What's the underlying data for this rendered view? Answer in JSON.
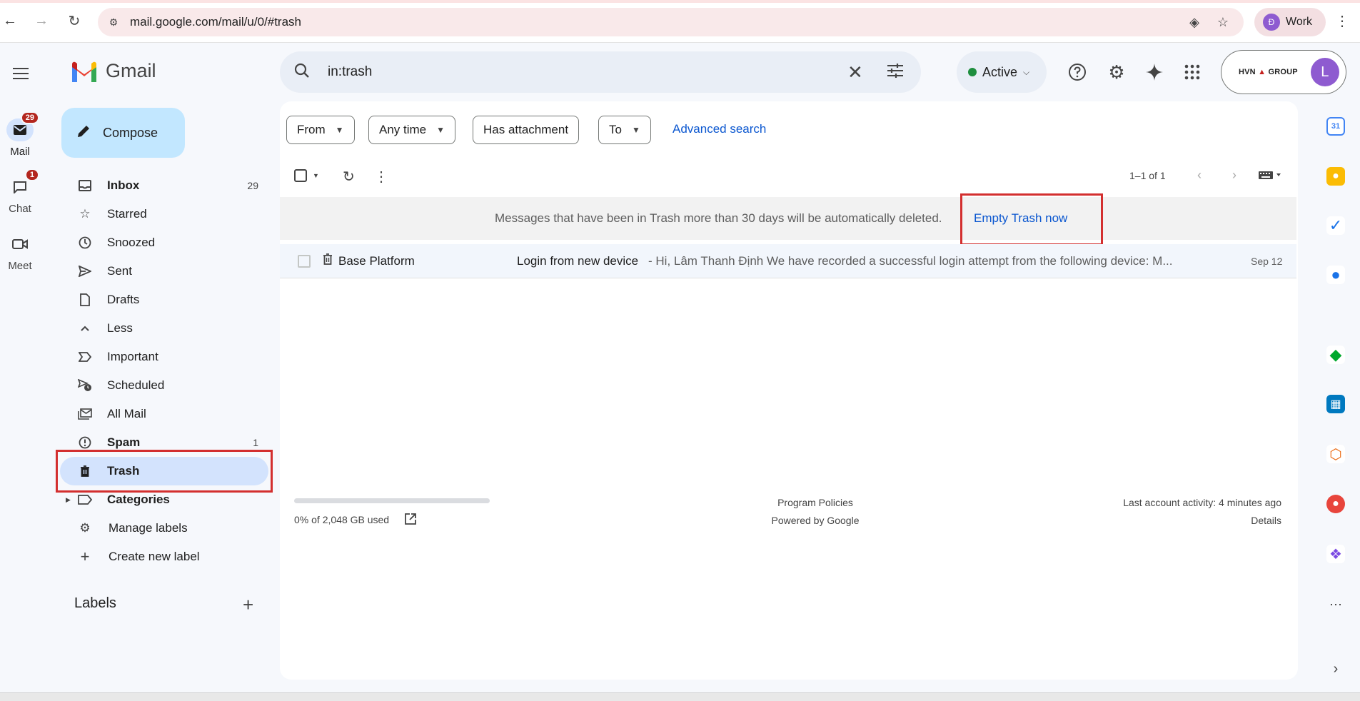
{
  "browser": {
    "url": "mail.google.com/mail/u/0/#trash",
    "profile_initial": "Đ",
    "profile_label": "Work"
  },
  "rail": {
    "mail_label": "Mail",
    "mail_badge": "29",
    "chat_label": "Chat",
    "chat_badge": "1",
    "meet_label": "Meet"
  },
  "app": {
    "name": "Gmail"
  },
  "compose_label": "Compose",
  "nav": [
    {
      "label": "Inbox",
      "count": "29",
      "icon": "inbox-icon"
    },
    {
      "label": "Starred",
      "count": "",
      "icon": "star-icon"
    },
    {
      "label": "Snoozed",
      "count": "",
      "icon": "clock-icon"
    },
    {
      "label": "Sent",
      "count": "",
      "icon": "send-icon"
    },
    {
      "label": "Drafts",
      "count": "",
      "icon": "draft-icon"
    },
    {
      "label": "Less",
      "count": "",
      "icon": "chevron-up-icon"
    },
    {
      "label": "Important",
      "count": "",
      "icon": "important-icon"
    },
    {
      "label": "Scheduled",
      "count": "",
      "icon": "scheduled-icon"
    },
    {
      "label": "All Mail",
      "count": "",
      "icon": "all-mail-icon"
    },
    {
      "label": "Spam",
      "count": "1",
      "icon": "spam-icon"
    },
    {
      "label": "Trash",
      "count": "",
      "icon": "trash-icon"
    },
    {
      "label": "Categories",
      "count": "",
      "icon": "label-icon"
    },
    {
      "label": "Manage labels",
      "count": "",
      "icon": "gear-icon"
    },
    {
      "label": "Create new label",
      "count": "",
      "icon": "plus-icon"
    }
  ],
  "labels_heading": "Labels",
  "search": {
    "value": "in:trash"
  },
  "status": {
    "label": "Active"
  },
  "account": {
    "org_part1": "HVN",
    "org_part2": "GROUP",
    "initial": "L"
  },
  "filters": {
    "from": "From",
    "any_time": "Any time",
    "has_attachment": "Has attachment",
    "to": "To",
    "advanced": "Advanced search"
  },
  "pager": "1–1 of 1",
  "notice": {
    "message": "Messages that have been in Trash more than 30 days will be automatically deleted.",
    "action": "Empty Trash now"
  },
  "emails": [
    {
      "sender": "Base Platform",
      "subject": "Login from new device",
      "snippet": " - Hi, Lâm Thanh Định We have recorded a successful login attempt from the following device: M...",
      "date": "Sep 12"
    }
  ],
  "footer": {
    "storage": "0% of 2,048 GB used",
    "storage_fraction": 0,
    "policies": "Program Policies",
    "powered": "Powered by Google",
    "activity": "Last account activity: 4 minutes ago",
    "details": "Details"
  },
  "colors": {
    "accent": "#0b57d0",
    "compose": "#c2e7ff",
    "active_nav": "#d3e3fd",
    "badge": "#b3261e",
    "highlight_box": "#d32f2f"
  }
}
